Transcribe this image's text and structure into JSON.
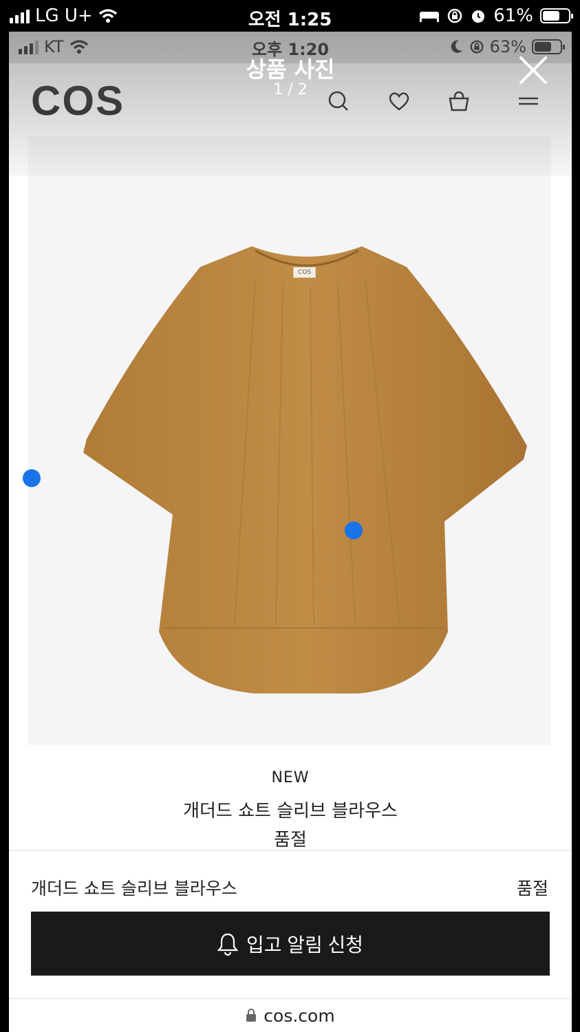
{
  "outer_status": {
    "carrier": "LG U+",
    "time": "오전 1:25",
    "battery": "61%"
  },
  "inner_status": {
    "carrier": "KT",
    "time": "오후 1:20",
    "battery": "63%"
  },
  "viewer": {
    "title": "상품 사진",
    "counter": "1 / 2"
  },
  "header": {
    "logo": "COS"
  },
  "photo": {
    "tag_text": "COS",
    "garment_color": "#b8853e"
  },
  "product": {
    "badge": "NEW",
    "name": "개더드 쇼트 슬리브 블라우스",
    "status": "품절"
  },
  "purchase_row": {
    "name": "개더드 쇼트 슬리브 블라우스",
    "status": "품절",
    "notify_label": "입고 알림 신청"
  },
  "url_bar": {
    "domain": "cos.com"
  },
  "colors": {
    "button_bg": "#1a1a1a",
    "touch_dot": "#1a73e8"
  }
}
